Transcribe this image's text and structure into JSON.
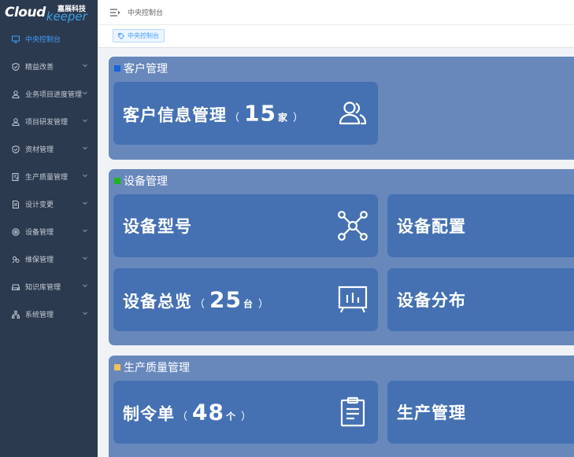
{
  "logo": {
    "primary": "Cloud",
    "secondary": "keeper",
    "company": "嘉展科技"
  },
  "sidebar": {
    "items": [
      {
        "label": "中央控制台",
        "icon": "monitor-icon",
        "active": true,
        "has_children": false
      },
      {
        "label": "精益改善",
        "icon": "shield-icon",
        "active": false,
        "has_children": true
      },
      {
        "label": "业务项目进度管理",
        "icon": "user-icon",
        "active": false,
        "has_children": true
      },
      {
        "label": "项目研发管理",
        "icon": "user-icon",
        "active": false,
        "has_children": true
      },
      {
        "label": "资材管理",
        "icon": "shield-icon",
        "active": false,
        "has_children": true
      },
      {
        "label": "生产质量管理",
        "icon": "document-edit-icon",
        "active": false,
        "has_children": true
      },
      {
        "label": "设计变更",
        "icon": "document-icon",
        "active": false,
        "has_children": true
      },
      {
        "label": "设备管理",
        "icon": "target-icon",
        "active": false,
        "has_children": true
      },
      {
        "label": "维保管理",
        "icon": "gear-cluster-icon",
        "active": false,
        "has_children": true
      },
      {
        "label": "知识库管理",
        "icon": "drive-icon",
        "active": false,
        "has_children": true
      },
      {
        "label": "系统管理",
        "icon": "org-chart-icon",
        "active": false,
        "has_children": true
      }
    ]
  },
  "header": {
    "breadcrumb": "中央控制台"
  },
  "tags": [
    {
      "label": "中央控制台",
      "icon": "tag-icon"
    }
  ],
  "colors": {
    "sidebar_bg": "#2c3a4f",
    "active": "#409eff",
    "section_bg": "#6888bc",
    "card_bg": "#4571b3",
    "customer_marker": "#1565d8",
    "equipment_marker": "#1db41d",
    "production_marker": "#f4c15a"
  },
  "sections": {
    "customer": {
      "title": "客户管理",
      "cards": [
        {
          "label": "客户信息管理",
          "count": "15",
          "unit": "家",
          "icon": "users-icon"
        }
      ]
    },
    "equipment": {
      "title": "设备管理",
      "cards": [
        {
          "label": "设备型号",
          "icon": "network-icon"
        },
        {
          "label": "设备配置"
        },
        {
          "label": "设备总览",
          "count": "25",
          "unit": "台",
          "icon": "chart-board-icon"
        },
        {
          "label": "设备分布"
        }
      ]
    },
    "production": {
      "title": "生产质量管理",
      "cards": [
        {
          "label": "制令单",
          "count": "48",
          "unit": "个",
          "icon": "clipboard-icon"
        },
        {
          "label": "生产管理"
        }
      ]
    }
  },
  "paren_open": "（",
  "paren_close": "）"
}
